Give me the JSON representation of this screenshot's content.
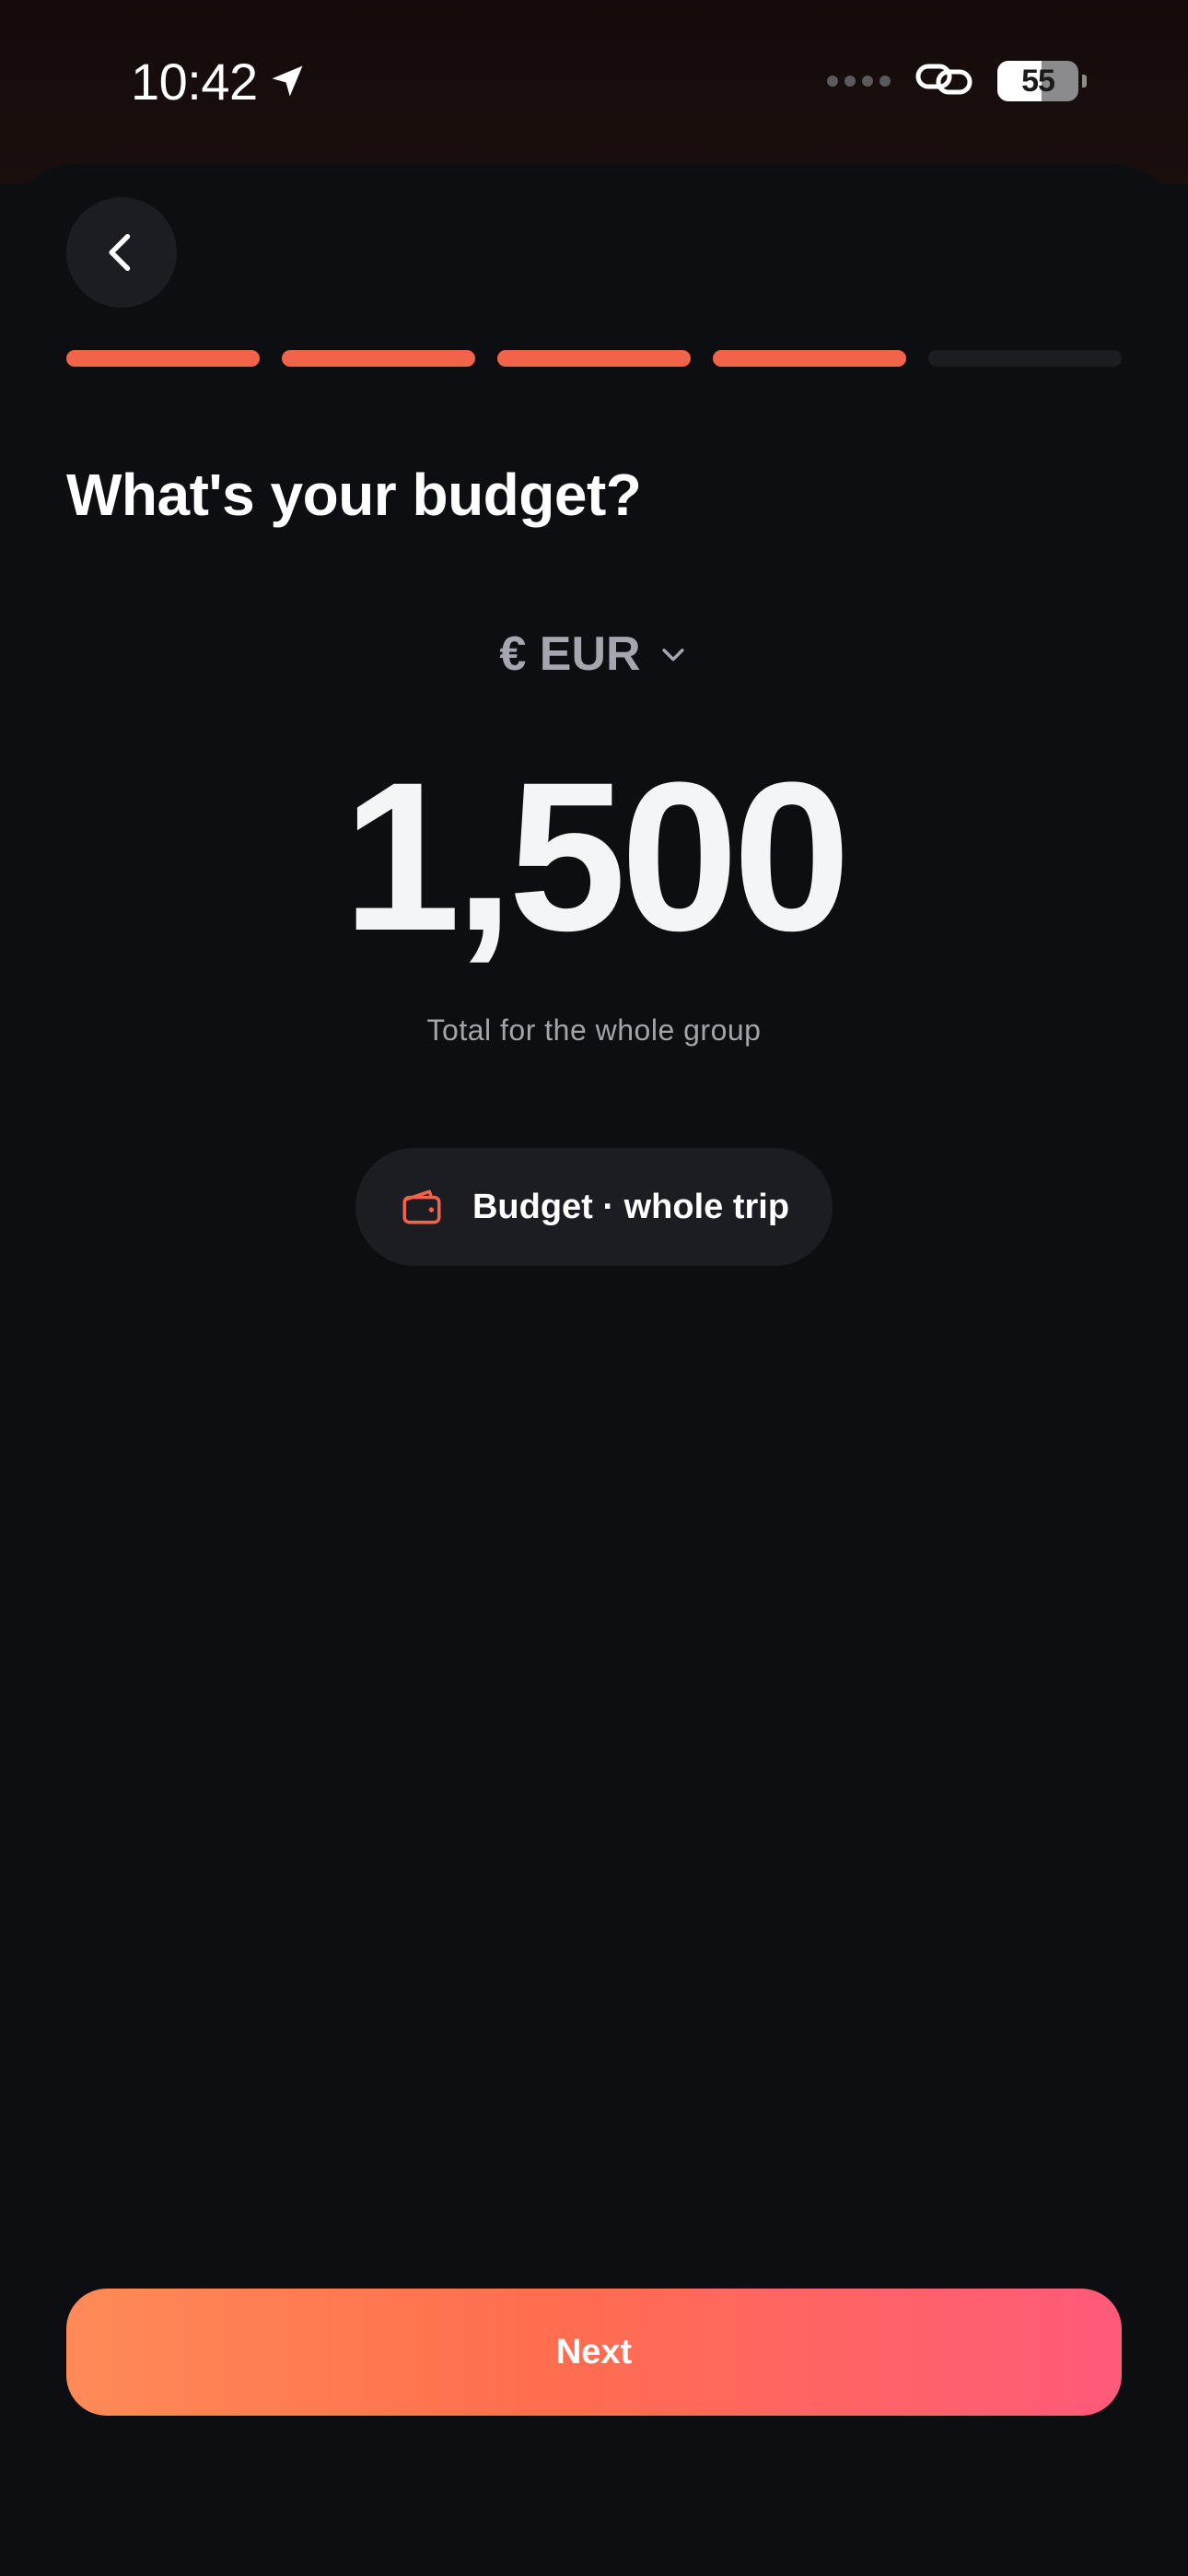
{
  "status_bar": {
    "time": "10:42",
    "battery_percent": "55",
    "battery_level": 0.55
  },
  "nav": {
    "back_icon": "chevron-left-icon"
  },
  "progress": {
    "total_steps": 5,
    "completed_steps": 4,
    "active_color": "#f2634a",
    "inactive_color": "#1c1d22"
  },
  "question": {
    "title": "What's your budget?"
  },
  "currency": {
    "label": "€ EUR",
    "dropdown_icon": "chevron-down-icon"
  },
  "budget": {
    "amount": "1,500",
    "helper": "Total for the whole group"
  },
  "scope_pill": {
    "icon": "wallet-icon",
    "label": "Budget · whole trip"
  },
  "footer": {
    "next_label": "Next"
  },
  "colors": {
    "accent": "#f2634a",
    "background": "#0d0e12",
    "surface": "#1c1d22",
    "button_gradient_start": "#ff8a58",
    "button_gradient_end": "#ff5a7a"
  }
}
